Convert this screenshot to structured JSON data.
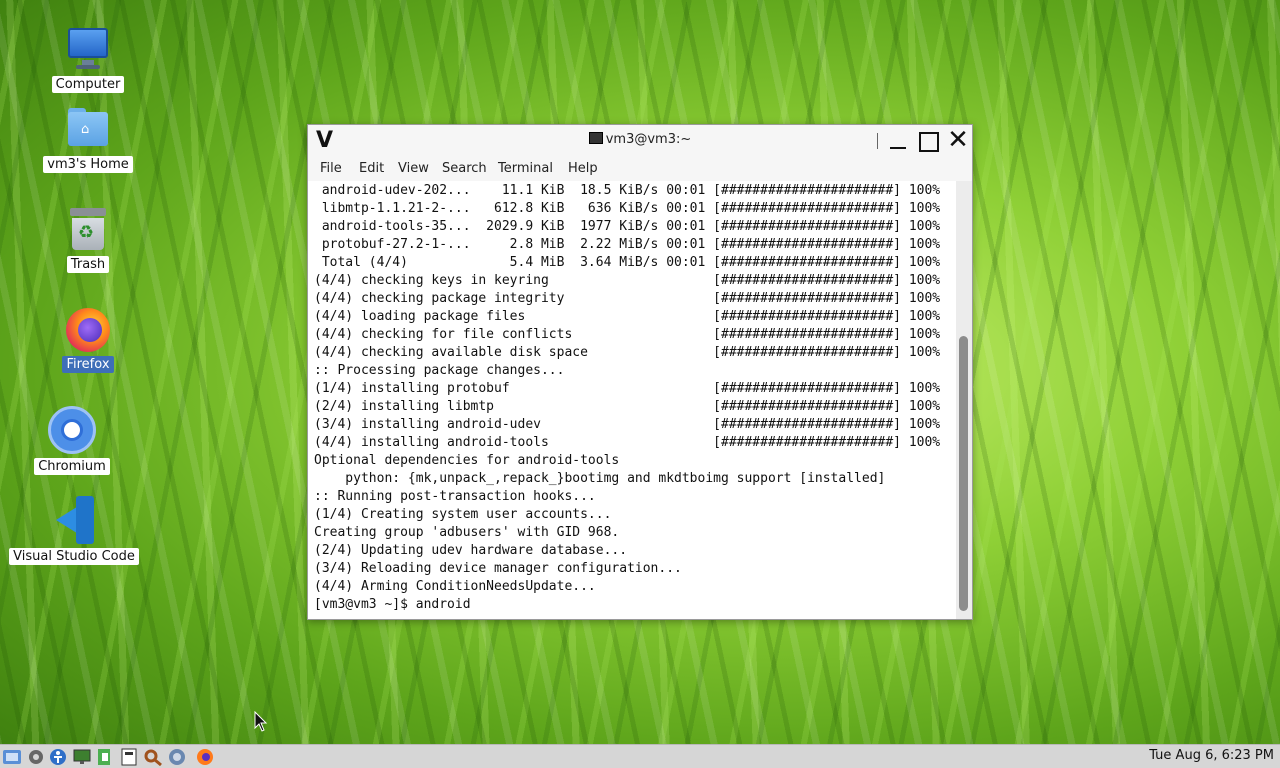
{
  "desktop": {
    "icons": [
      {
        "label": "Computer",
        "icon": "computer-icon"
      },
      {
        "label": "vm3's Home",
        "icon": "home-folder-icon"
      },
      {
        "label": "Trash",
        "icon": "trash-icon"
      },
      {
        "label": "Firefox",
        "icon": "firefox-icon"
      },
      {
        "label": "Chromium",
        "icon": "chromium-icon"
      },
      {
        "label": "Visual Studio Code",
        "icon": "vscode-icon"
      }
    ]
  },
  "window": {
    "logo": "V",
    "title": "vm3@vm3:~",
    "menu": [
      "File",
      "Edit",
      "View",
      "Search",
      "Terminal",
      "Help"
    ],
    "close_glyph": "✕"
  },
  "terminal": {
    "lines": [
      " android-udev-202...    11.1 KiB  18.5 KiB/s 00:01 [######################] 100%",
      " libmtp-1.1.21-2-...   612.8 KiB   636 KiB/s 00:01 [######################] 100%",
      " android-tools-35...  2029.9 KiB  1977 KiB/s 00:01 [######################] 100%",
      " protobuf-27.2-1-...     2.8 MiB  2.22 MiB/s 00:01 [######################] 100%",
      " Total (4/4)             5.4 MiB  3.64 MiB/s 00:01 [######################] 100%",
      "(4/4) checking keys in keyring                     [######################] 100%",
      "(4/4) checking package integrity                   [######################] 100%",
      "(4/4) loading package files                        [######################] 100%",
      "(4/4) checking for file conflicts                  [######################] 100%",
      "(4/4) checking available disk space                [######################] 100%",
      ":: Processing package changes...",
      "(1/4) installing protobuf                          [######################] 100%",
      "(2/4) installing libmtp                            [######################] 100%",
      "(3/4) installing android-udev                      [######################] 100%",
      "(4/4) installing android-tools                     [######################] 100%",
      "Optional dependencies for android-tools",
      "    python: {mk,unpack_,repack_}bootimg and mkdtboimg support [installed]",
      ":: Running post-transaction hooks...",
      "(1/4) Creating system user accounts...",
      "Creating group 'adbusers' with GID 968.",
      "(2/4) Updating udev hardware database...",
      "(3/4) Reloading device manager configuration...",
      "(4/4) Arming ConditionNeedsUpdate...",
      "[vm3@vm3 ~]$ android"
    ]
  },
  "taskbar": {
    "items": [
      "start-menu-icon",
      "settings-icon",
      "accessibility-icon",
      "monitor-icon",
      "logout-icon",
      "terminal-icon",
      "search-icon",
      "network-icon",
      "firefox-icon"
    ],
    "clock": "Tue Aug  6,  6:23 PM"
  }
}
